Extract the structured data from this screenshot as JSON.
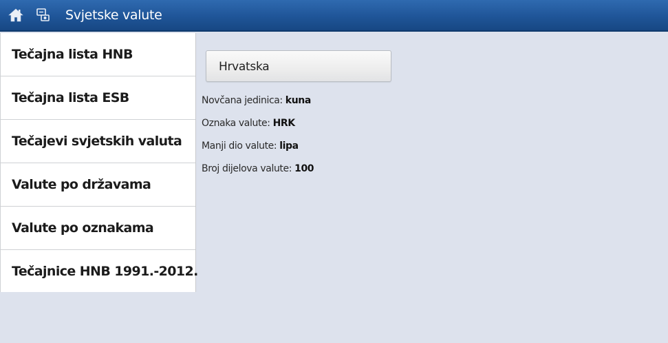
{
  "app_bar": {
    "title": "Svjetske valute",
    "home_icon": "home-icon",
    "app_icon": "currency-app-icon",
    "background": "#1f5598"
  },
  "sidebar": {
    "items": [
      {
        "label": "Tečajna lista HNB"
      },
      {
        "label": "Tečajna lista ESB"
      },
      {
        "label": "Tečajevi svjetskih valuta"
      },
      {
        "label": "Valute po državama"
      },
      {
        "label": "Valute po oznakama"
      },
      {
        "label": "Tečajnice HNB 1991.-2012."
      }
    ]
  },
  "main": {
    "country_button_label": "Hrvatska",
    "details": [
      {
        "label": "Novčana jedinica: ",
        "value": "kuna"
      },
      {
        "label": "Oznaka valute: ",
        "value": "HRK"
      },
      {
        "label": "Manji dio valute: ",
        "value": "lipa"
      },
      {
        "label": "Broj dijelova valute: ",
        "value": "100"
      }
    ]
  }
}
